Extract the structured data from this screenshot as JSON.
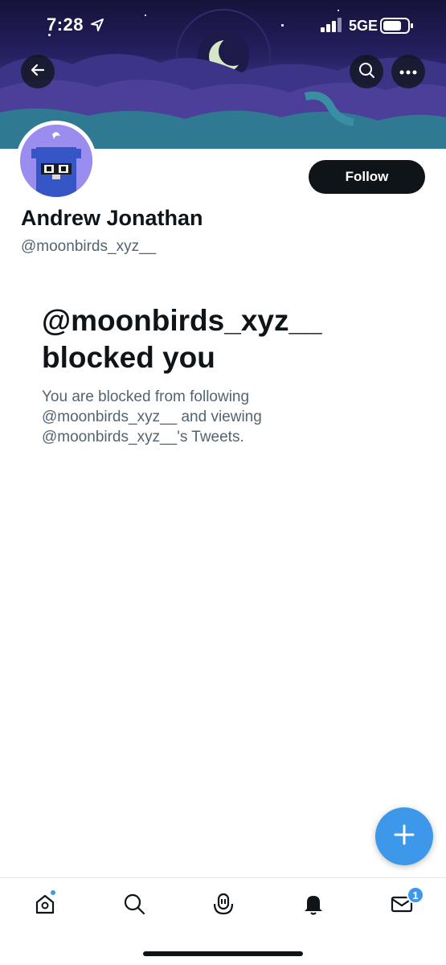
{
  "status_bar": {
    "time": "7:28",
    "network": "5GE",
    "icons": [
      "location-arrow-icon",
      "signal-icon",
      "battery-icon"
    ]
  },
  "header": {
    "icons": [
      "back-arrow-icon",
      "search-icon",
      "more-icon"
    ]
  },
  "profile": {
    "display_name": "Andrew Jonathan",
    "handle": "@moonbirds_xyz__",
    "follow_label": "Follow"
  },
  "blocked": {
    "title": "@moonbirds_xyz__ blocked you",
    "description": "You are blocked from following @moonbirds_xyz__ and viewing @moonbirds_xyz__'s Tweets."
  },
  "bottom_nav": {
    "items": [
      {
        "name": "home",
        "icon": "home-icon",
        "has_dot": true
      },
      {
        "name": "search",
        "icon": "search-icon"
      },
      {
        "name": "spaces",
        "icon": "spaces-icon"
      },
      {
        "name": "notifications",
        "icon": "bell-icon"
      },
      {
        "name": "messages",
        "icon": "mail-icon",
        "badge": "1"
      }
    ]
  },
  "colors": {
    "accent": "#3d98ea",
    "text_primary": "#0f1419",
    "text_secondary": "#536471"
  }
}
